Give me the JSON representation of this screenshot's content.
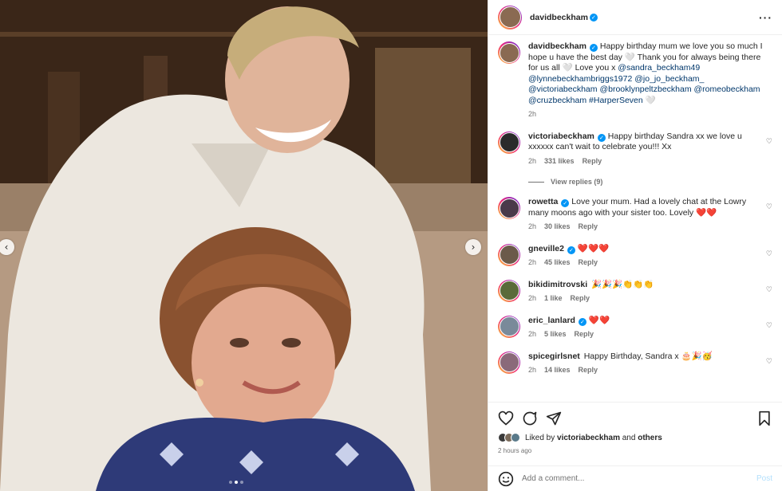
{
  "post": {
    "author": "davidbeckham",
    "caption_parts": [
      {
        "t": "text",
        "v": "Happy birthday mum we love you so much I hope u have the best day 🤍 Thank you for always being there for us all 🤍 Love you x "
      },
      {
        "t": "mention",
        "v": "@sandra_beckham49"
      },
      {
        "t": "text",
        "v": " "
      },
      {
        "t": "mention",
        "v": "@lynnebeckhambriggs1972"
      },
      {
        "t": "text",
        "v": " "
      },
      {
        "t": "mention",
        "v": "@jo_jo_beckham_"
      },
      {
        "t": "text",
        "v": " "
      },
      {
        "t": "mention",
        "v": "@victoriabeckham"
      },
      {
        "t": "text",
        "v": " "
      },
      {
        "t": "mention",
        "v": "@brooklynpeltzbeckham"
      },
      {
        "t": "text",
        "v": " "
      },
      {
        "t": "mention",
        "v": "@romeobeckham"
      },
      {
        "t": "text",
        "v": " "
      },
      {
        "t": "mention",
        "v": "@cruzbeckham"
      },
      {
        "t": "text",
        "v": " "
      },
      {
        "t": "mention",
        "v": "#HarperSeven"
      },
      {
        "t": "text",
        "v": " 🤍"
      }
    ],
    "caption_time": "2h",
    "liked_by_prefix": "Liked by",
    "liked_by_user": "victoriabeckham",
    "liked_by_and": "and",
    "liked_by_others": "others",
    "posted_ago": "2 hours ago"
  },
  "comments": [
    {
      "user": "victoriabeckham",
      "verified": true,
      "text": "Happy birthday Sandra xx we love u xxxxxx can't wait to celebrate you!!! Xx",
      "time": "2h",
      "likes": "331 likes",
      "reply": "Reply",
      "view_replies": "View replies (9)",
      "avatar": "#2b2b2b"
    },
    {
      "user": "rowetta",
      "verified": true,
      "text": "Love your mum. Had a lovely chat at the Lowry many moons ago with your sister too. Lovely ❤️❤️",
      "time": "2h",
      "likes": "30 likes",
      "reply": "Reply",
      "avatar": "#4a3a4a"
    },
    {
      "user": "gneville2",
      "verified": true,
      "text": "❤️❤️❤️",
      "time": "2h",
      "likes": "45 likes",
      "reply": "Reply",
      "avatar": "#6b5a4a"
    },
    {
      "user": "bikidimitrovski",
      "verified": false,
      "text": "🎉🎉🎉👏👏👏",
      "time": "2h",
      "likes": "1 like",
      "reply": "Reply",
      "avatar": "#5a6a3a"
    },
    {
      "user": "eric_lanlard",
      "verified": true,
      "text": "❤️❤️",
      "time": "2h",
      "likes": "5 likes",
      "reply": "Reply",
      "avatar": "#7a8a9a"
    },
    {
      "user": "spicegirlsnet",
      "verified": false,
      "text": "Happy Birthday, Sandra x 🎂🎉🥳",
      "time": "2h",
      "likes": "14 likes",
      "reply": "Reply",
      "avatar": "#8a6a7a"
    }
  ],
  "add_comment": {
    "placeholder": "Add a comment...",
    "post_label": "Post"
  },
  "icons": {
    "like": "heart-icon",
    "comment": "comment-icon",
    "share": "share-icon",
    "save": "bookmark-icon",
    "emoji": "emoji-icon",
    "more": "more-options-icon"
  },
  "colors": {
    "link": "#00376b",
    "verified": "#0095f6",
    "muted": "#737373",
    "post_disabled": "#b2dffc"
  },
  "carousel": {
    "slides": 3,
    "active": 1
  }
}
